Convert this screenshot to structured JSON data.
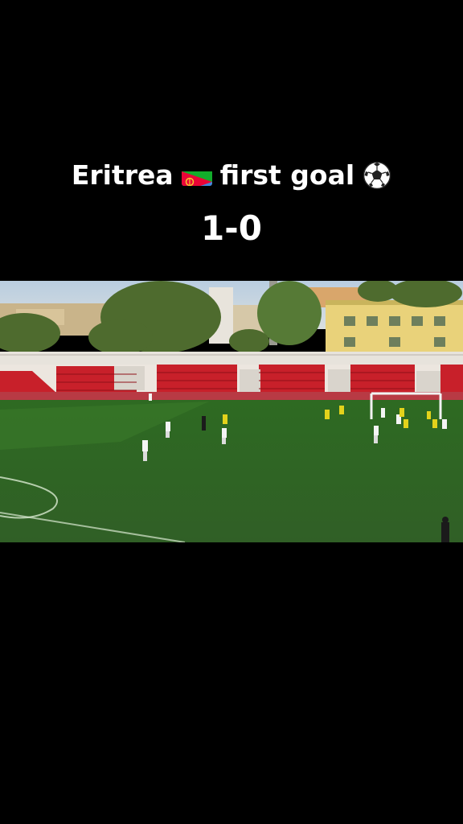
{
  "caption": {
    "title_left": "Eritrea",
    "title_right": "first goal",
    "flag_icon": "eritrea-flag-icon",
    "ball_icon": "soccer-ball-icon",
    "score": "1-0"
  },
  "colors": {
    "background": "#000000",
    "text": "#ffffff",
    "pitch": "#2f6b27",
    "seats_red": "#c8202a",
    "building_yellow": "#e9d27a",
    "eritrea_green": "#12ad2b",
    "eritrea_blue": "#4189dd",
    "eritrea_red": "#ea0437",
    "team_white": "#f4f4f4",
    "team_yellow": "#e3d21b"
  }
}
